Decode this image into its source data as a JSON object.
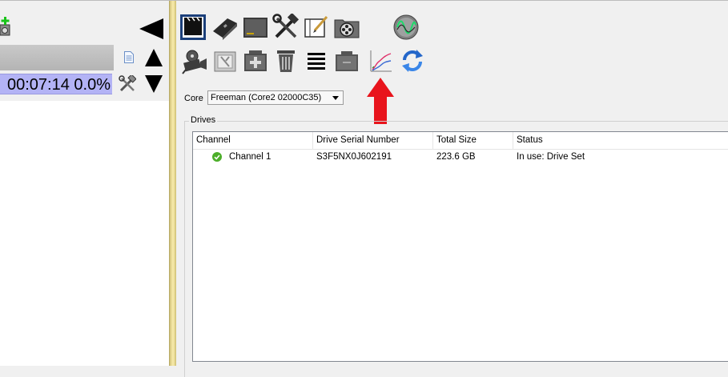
{
  "left_panel": {
    "time_display": "00:07:14 0.0%"
  },
  "core": {
    "label": "Core",
    "selected": "Freeman (Core2 02000C35)"
  },
  "drives": {
    "title": "Drives",
    "columns": [
      "Channel",
      "Drive Serial Number",
      "Total Size",
      "Status"
    ],
    "rows": [
      {
        "channel": "Channel 1",
        "serial": "S3F5NX0J602191",
        "size": "223.6 GB",
        "status": "In use: Drive Set",
        "status_icon": "green-check-icon"
      }
    ]
  },
  "toolbar_icons": {
    "row1": [
      "clapper-icon",
      "nvr-device-icon",
      "storage-box-icon",
      "tools-icon",
      "notepad-icon",
      "film-reel-icon",
      "waveform-icon"
    ],
    "row2": [
      "film-camera-icon",
      "disk-cleanup-icon",
      "add-drive-icon",
      "trash-icon",
      "list-icon",
      "drive-case-icon",
      "graph-icon",
      "refresh-icon"
    ],
    "annotation": "red-up-arrow-icon"
  },
  "colors": {
    "time_highlight": "#b3b3f5",
    "splitter": "#f4e7a6",
    "annotation_arrow": "#e8141c",
    "check_green": "#4cae2a"
  }
}
